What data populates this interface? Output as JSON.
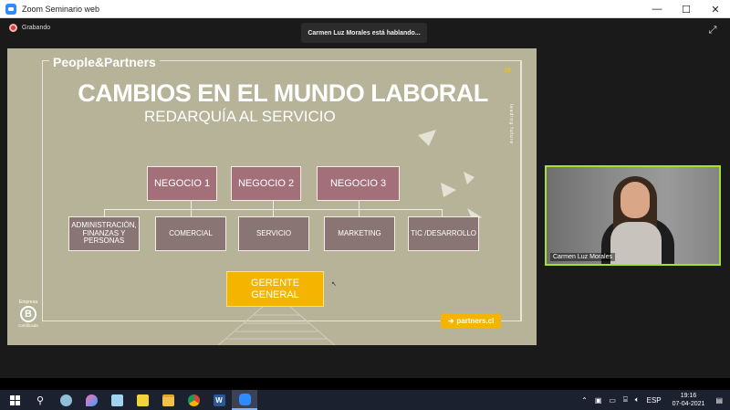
{
  "window": {
    "title": "Zoom Seminario web",
    "minimize": "—",
    "maximize": "☐",
    "close": "✕"
  },
  "meeting": {
    "recording_label": "Grabando",
    "speaking_banner": "Carmen Luz Morales está hablando..."
  },
  "slide": {
    "brand": "People&Partners",
    "title": "CAMBIOS EN EL MUNDO LABORAL",
    "subtitle": "REDARQUÍA AL SERVICIO",
    "year_tag": "20",
    "vertical_text": "leading future",
    "business_units": [
      "NEGOCIO 1",
      "NEGOCIO 2",
      "NEGOCIO 3"
    ],
    "departments": [
      "ADMINISTRACIÓN, FINANZAS Y PERSONAS",
      "COMERCIAL",
      "SERVICIO",
      "MARKETING",
      "TIC /DESARROLLO"
    ],
    "manager": "GERENTE GENERAL",
    "badge_top": "Empresa",
    "badge_letter": "B",
    "badge_bottom": "Certificada",
    "website": "partners.cl",
    "website_icon": "arrow-circle-icon"
  },
  "video": {
    "participant_name": "Carmen Luz Morales",
    "border_color": "#a6e02a"
  },
  "taskbar": {
    "language": "ESP",
    "time": "19:16",
    "date": "07-04-2021",
    "word_label": "W"
  },
  "colors": {
    "slide_bg": "#b6b398",
    "negocio": "#a3707a",
    "department": "#8a7575",
    "accent": "#f5b400",
    "zoom_blue": "#2d8cff"
  }
}
